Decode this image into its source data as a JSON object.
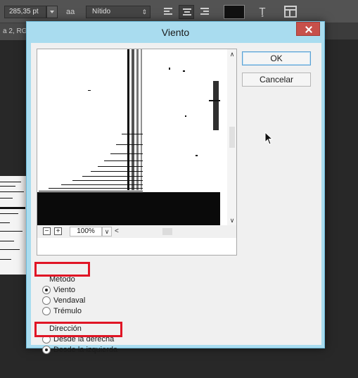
{
  "options_bar": {
    "font_size": "285,35 pt",
    "antialias_icon": "aa",
    "antialias_value": "Nítido"
  },
  "document": {
    "tab_label": "a 2, RG"
  },
  "dialog": {
    "title": "Viento",
    "ok_label": "OK",
    "cancel_label": "Cancelar",
    "zoom_value": "100%",
    "method": {
      "label": "Método",
      "options": [
        "Viento",
        "Vendaval",
        "Trémulo"
      ],
      "selected": "Viento"
    },
    "direction": {
      "label": "Dirección",
      "options": [
        "Desde la derecha",
        "Desde la izquierda"
      ],
      "selected": "Desde la izquierda"
    }
  },
  "colors": {
    "dialog_frame": "#a9dcef",
    "close_button": "#c7504a",
    "highlight": "#e01525",
    "workspace": "#282828"
  }
}
